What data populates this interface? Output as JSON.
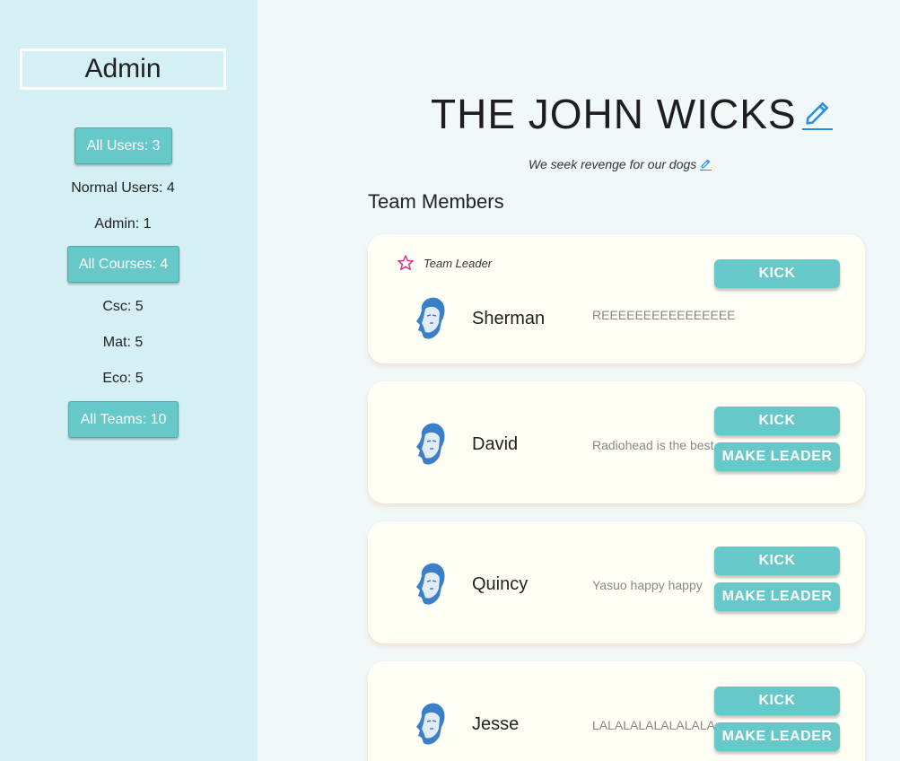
{
  "sidebar": {
    "title": "Admin",
    "all_users": "All Users: 3",
    "normal_users": "Normal Users: 4",
    "admin": "Admin: 1",
    "all_courses": "All Courses: 4",
    "csc": "Csc: 5",
    "mat": "Mat: 5",
    "eco": "Eco: 5",
    "all_teams": "All Teams: 10"
  },
  "team": {
    "name": "THE JOHN WICKS",
    "description": "We seek revenge for our dogs",
    "members_heading": "Team Members"
  },
  "members": [
    {
      "name": "Sherman",
      "motto": "REEEEEEEEEEEEEEEE",
      "leader_label": "Team Leader",
      "kick": "KICK"
    },
    {
      "name": "David",
      "motto": "Radiohead is the best",
      "kick": "KICK",
      "make_leader": "MAKE LEADER"
    },
    {
      "name": "Quincy",
      "motto": "Yasuo happy happy",
      "kick": "KICK",
      "make_leader": "MAKE LEADER"
    },
    {
      "name": "Jesse",
      "motto": "LALALALALALALALA",
      "kick": "KICK",
      "make_leader": "MAKE LEADER"
    }
  ],
  "colors": {
    "accent": "#66c8c8",
    "sidebar_bg": "#d5f0f4",
    "page_bg": "#f0f8fa",
    "card_bg": "#fffff6",
    "edit_icon": "#2a8ee0",
    "star_icon": "#e0308a"
  },
  "icons": {
    "edit": "pencil-icon",
    "leader": "star-icon",
    "avatar": "user-avatar-icon"
  }
}
